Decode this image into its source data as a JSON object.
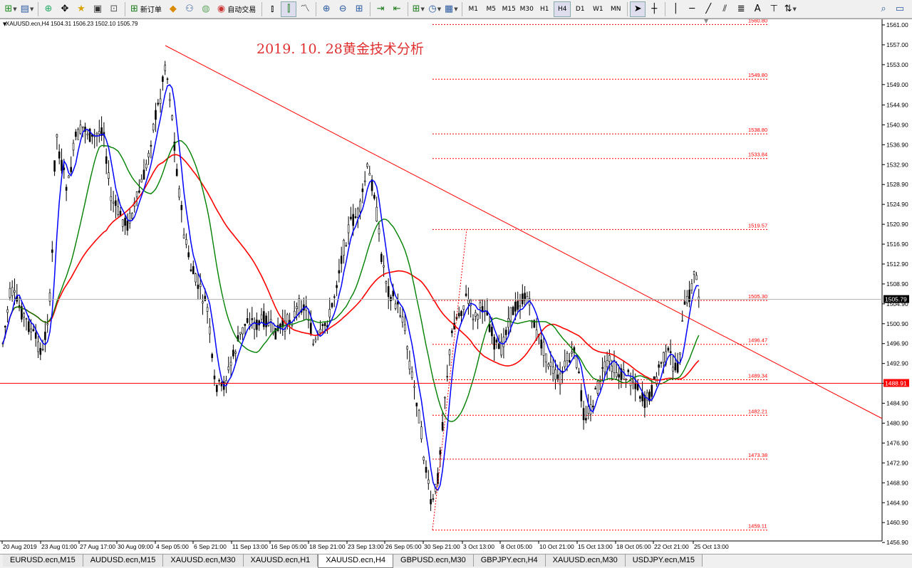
{
  "toolbar": {
    "new_order_label": "新订单",
    "autotrading_label": "自动交易",
    "timeframes": [
      "M1",
      "M5",
      "M15",
      "M30",
      "H1",
      "H4",
      "D1",
      "W1",
      "MN"
    ],
    "active_timeframe": "H4"
  },
  "chart": {
    "header": "XAUUSD.ecn,H4  1504.31 1506.23 1502.10 1505.79",
    "annotation_title": "2019. 10. 28黄金技术分析",
    "current_price_label": "1505.79",
    "horizontal_line_label": "1488.91",
    "price_axis_labels": [
      "1561.00",
      "1557.00",
      "1553.00",
      "1549.00",
      "1544.90",
      "1540.90",
      "1536.90",
      "1532.90",
      "1528.90",
      "1524.90",
      "1520.90",
      "1516.90",
      "1512.90",
      "1508.90",
      "1504.90",
      "1500.90",
      "1496.90",
      "1492.90",
      "1488.90",
      "1484.90",
      "1480.90",
      "1476.90",
      "1472.90",
      "1468.90",
      "1464.90",
      "1460.90",
      "1456.90"
    ],
    "time_axis_labels": [
      "20 Aug 2019",
      "23 Aug 01:00",
      "27 Aug 17:00",
      "30 Aug 09:00",
      "4 Sep 05:00",
      "6 Sep 21:00",
      "11 Sep 13:00",
      "16 Sep 05:00",
      "18 Sep 21:00",
      "23 Sep 13:00",
      "26 Sep 05:00",
      "30 Sep 21:00",
      "3 Oct 13:00",
      "8 Oct 05:00",
      "10 Oct 21:00",
      "15 Oct 13:00",
      "18 Oct 05:00",
      "22 Oct 21:00",
      "25 Oct 13:00"
    ],
    "fib_levels": [
      "1560.80",
      "1549.80",
      "1538.80",
      "1533.84",
      "1519.57",
      "1505.30",
      "1496.47",
      "1489.34",
      "1482.21",
      "1473.38",
      "1459.11"
    ],
    "colors": {
      "trendline": "#ff0000",
      "ma_fast": "#0000ff",
      "ma_mid": "#008000",
      "ma_slow": "#ff0000",
      "candles": "#000000",
      "fib": "#ff0000"
    }
  },
  "tabs": [
    "EURUSD.ecn,M15",
    "AUDUSD.ecn,M15",
    "XAUUSD.ecn,M30",
    "XAUUSD.ecn,H1",
    "XAUUSD.ecn,H4",
    "GBPUSD.ecn,M30",
    "GBPJPY.ecn,H4",
    "XAUUSD.ecn,M30",
    "USDJPY.ecn,M15"
  ],
  "active_tab": "XAUUSD.ecn,H4"
}
